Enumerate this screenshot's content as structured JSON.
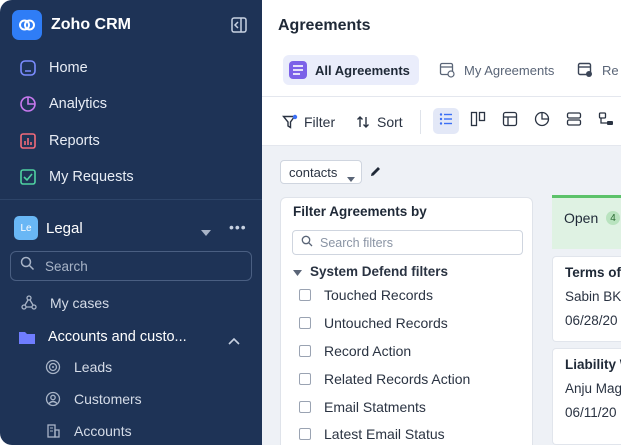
{
  "sidebar": {
    "brand": "Zoho CRM",
    "nav": [
      {
        "label": "Home",
        "icon": "home-icon"
      },
      {
        "label": "Analytics",
        "icon": "analytics-icon"
      },
      {
        "label": "Reports",
        "icon": "reports-icon"
      },
      {
        "label": "My Requests",
        "icon": "requests-icon"
      }
    ],
    "workspace": {
      "avatar": "Le",
      "name": "Legal"
    },
    "search_placeholder": "Search",
    "items": [
      {
        "label": "My cases",
        "icon": "cases-icon"
      },
      {
        "label": "Accounts and custo...",
        "icon": "folder-icon"
      },
      {
        "label": "Leads",
        "icon": "leads-icon"
      },
      {
        "label": "Customers",
        "icon": "customers-icon"
      },
      {
        "label": "Accounts",
        "icon": "accounts-icon"
      }
    ],
    "colors": {
      "bg": "#1e3356",
      "accent": "#2f7df6"
    }
  },
  "main": {
    "title": "Agreements",
    "tabs": [
      {
        "label": "All Agreements",
        "active": true
      },
      {
        "label": "My Agreements",
        "active": false
      },
      {
        "label": "Re",
        "active": false
      }
    ],
    "toolbar": {
      "filter_label": "Filter",
      "sort_label": "Sort"
    },
    "context_select": "contacts",
    "filter_panel": {
      "title": "Filter Agreements by",
      "search_placeholder": "Search filters",
      "group": "System Defend filters",
      "options": [
        "Touched Records",
        "Untouched Records",
        "Record Action",
        "Related Records Action",
        "Email Statments",
        "Latest Email Status"
      ]
    },
    "kanban": {
      "column": {
        "label": "Open",
        "count": "4"
      },
      "cards": [
        {
          "title": "Terms of",
          "owner": "Sabin BK",
          "date": "06/28/20"
        },
        {
          "title": "Liability W",
          "owner": "Anju Mag",
          "date": "06/11/20"
        }
      ]
    }
  }
}
